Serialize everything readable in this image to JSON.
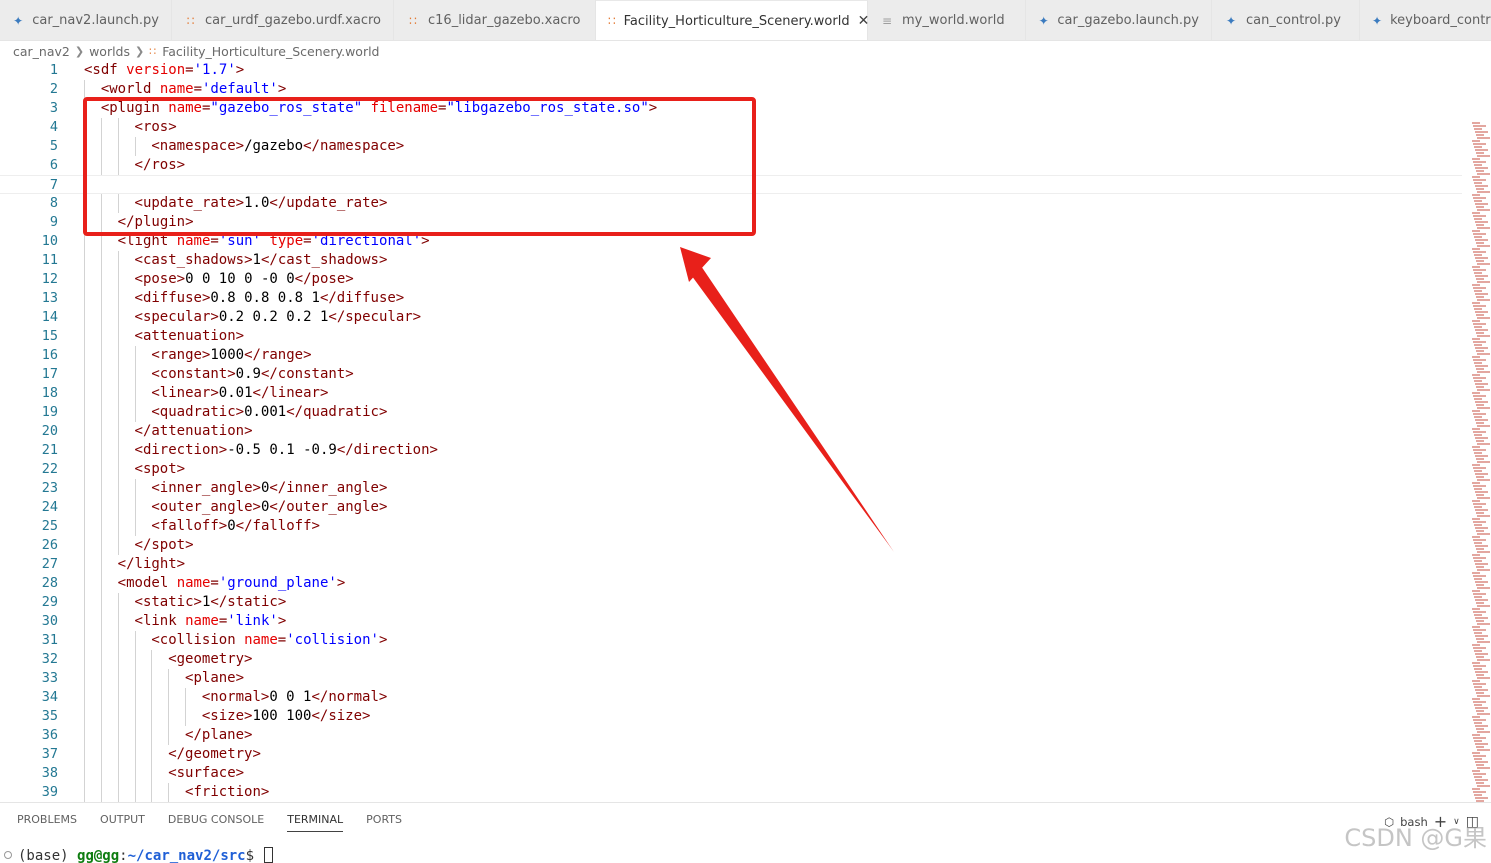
{
  "tabs": [
    {
      "label": "car_nav2.launch.py",
      "icon": "python-icon",
      "active": false
    },
    {
      "label": "car_urdf_gazebo.urdf.xacro",
      "icon": "rss-icon",
      "active": false
    },
    {
      "label": "c16_lidar_gazebo.xacro",
      "icon": "rss-icon",
      "active": false
    },
    {
      "label": "Facility_Horticulture_Scenery.world",
      "icon": "rss-icon",
      "active": true
    },
    {
      "label": "my_world.world",
      "icon": "lines-icon",
      "active": false
    },
    {
      "label": "car_gazebo.launch.py",
      "icon": "python-icon",
      "active": false
    },
    {
      "label": "can_control.py",
      "icon": "python-icon",
      "active": false
    },
    {
      "label": "keyboard_control.",
      "icon": "python-icon",
      "active": false
    }
  ],
  "breadcrumb": [
    "car_nav2",
    "worlds",
    "Facility_Horticulture_Scenery.world"
  ],
  "editor": {
    "current_line": 7,
    "lines": [
      {
        "n": "1",
        "indent": 0,
        "tokens": [
          [
            "tag",
            "<sdf "
          ],
          [
            "attr",
            "version"
          ],
          [
            "tag",
            "="
          ],
          [
            "str",
            "'1.7'"
          ],
          [
            "tag",
            ">"
          ]
        ]
      },
      {
        "n": "2",
        "indent": 1,
        "tokens": [
          [
            "tag",
            "<world "
          ],
          [
            "attr",
            "name"
          ],
          [
            "tag",
            "="
          ],
          [
            "str",
            "'default'"
          ],
          [
            "tag",
            ">"
          ]
        ]
      },
      {
        "n": "3",
        "indent": 1,
        "tokens": [
          [
            "tag",
            "<plugin "
          ],
          [
            "attr",
            "name"
          ],
          [
            "tag",
            "="
          ],
          [
            "str",
            "\"gazebo_ros_state\""
          ],
          [
            "tag",
            " "
          ],
          [
            "attr",
            "filename"
          ],
          [
            "tag",
            "="
          ],
          [
            "str",
            "\"libgazebo_ros_state.so\""
          ],
          [
            "tag",
            ">"
          ]
        ]
      },
      {
        "n": "4",
        "indent": 3,
        "tokens": [
          [
            "tag",
            "<ros>"
          ]
        ]
      },
      {
        "n": "5",
        "indent": 4,
        "tokens": [
          [
            "tag",
            "<namespace>"
          ],
          [
            "text",
            "/gazebo"
          ],
          [
            "tag",
            "</namespace>"
          ]
        ]
      },
      {
        "n": "6",
        "indent": 3,
        "tokens": [
          [
            "tag",
            "</ros>"
          ]
        ]
      },
      {
        "n": "7",
        "indent": 0,
        "tokens": []
      },
      {
        "n": "8",
        "indent": 3,
        "tokens": [
          [
            "tag",
            "<update_rate>"
          ],
          [
            "text",
            "1.0"
          ],
          [
            "tag",
            "</update_rate>"
          ]
        ]
      },
      {
        "n": "9",
        "indent": 2,
        "tokens": [
          [
            "tag",
            "</plugin>"
          ]
        ]
      },
      {
        "n": "10",
        "indent": 2,
        "tokens": [
          [
            "tag",
            "<light "
          ],
          [
            "attr",
            "name"
          ],
          [
            "tag",
            "="
          ],
          [
            "str",
            "'sun'"
          ],
          [
            "tag",
            " "
          ],
          [
            "attr",
            "type"
          ],
          [
            "tag",
            "="
          ],
          [
            "str",
            "'directional'"
          ],
          [
            "tag",
            ">"
          ]
        ]
      },
      {
        "n": "11",
        "indent": 3,
        "tokens": [
          [
            "tag",
            "<cast_shadows>"
          ],
          [
            "text",
            "1"
          ],
          [
            "tag",
            "</cast_shadows>"
          ]
        ]
      },
      {
        "n": "12",
        "indent": 3,
        "tokens": [
          [
            "tag",
            "<pose>"
          ],
          [
            "text",
            "0 0 10 0 -0 0"
          ],
          [
            "tag",
            "</pose>"
          ]
        ]
      },
      {
        "n": "13",
        "indent": 3,
        "tokens": [
          [
            "tag",
            "<diffuse>"
          ],
          [
            "text",
            "0.8 0.8 0.8 1"
          ],
          [
            "tag",
            "</diffuse>"
          ]
        ]
      },
      {
        "n": "14",
        "indent": 3,
        "tokens": [
          [
            "tag",
            "<specular>"
          ],
          [
            "text",
            "0.2 0.2 0.2 1"
          ],
          [
            "tag",
            "</specular>"
          ]
        ]
      },
      {
        "n": "15",
        "indent": 3,
        "tokens": [
          [
            "tag",
            "<attenuation>"
          ]
        ]
      },
      {
        "n": "16",
        "indent": 4,
        "tokens": [
          [
            "tag",
            "<range>"
          ],
          [
            "text",
            "1000"
          ],
          [
            "tag",
            "</range>"
          ]
        ]
      },
      {
        "n": "17",
        "indent": 4,
        "tokens": [
          [
            "tag",
            "<constant>"
          ],
          [
            "text",
            "0.9"
          ],
          [
            "tag",
            "</constant>"
          ]
        ]
      },
      {
        "n": "18",
        "indent": 4,
        "tokens": [
          [
            "tag",
            "<linear>"
          ],
          [
            "text",
            "0.01"
          ],
          [
            "tag",
            "</linear>"
          ]
        ]
      },
      {
        "n": "19",
        "indent": 4,
        "tokens": [
          [
            "tag",
            "<quadratic>"
          ],
          [
            "text",
            "0.001"
          ],
          [
            "tag",
            "</quadratic>"
          ]
        ]
      },
      {
        "n": "20",
        "indent": 3,
        "tokens": [
          [
            "tag",
            "</attenuation>"
          ]
        ]
      },
      {
        "n": "21",
        "indent": 3,
        "tokens": [
          [
            "tag",
            "<direction>"
          ],
          [
            "text",
            "-0.5 0.1 -0.9"
          ],
          [
            "tag",
            "</direction>"
          ]
        ]
      },
      {
        "n": "22",
        "indent": 3,
        "tokens": [
          [
            "tag",
            "<spot>"
          ]
        ]
      },
      {
        "n": "23",
        "indent": 4,
        "tokens": [
          [
            "tag",
            "<inner_angle>"
          ],
          [
            "text",
            "0"
          ],
          [
            "tag",
            "</inner_angle>"
          ]
        ]
      },
      {
        "n": "24",
        "indent": 4,
        "tokens": [
          [
            "tag",
            "<outer_angle>"
          ],
          [
            "text",
            "0"
          ],
          [
            "tag",
            "</outer_angle>"
          ]
        ]
      },
      {
        "n": "25",
        "indent": 4,
        "tokens": [
          [
            "tag",
            "<falloff>"
          ],
          [
            "text",
            "0"
          ],
          [
            "tag",
            "</falloff>"
          ]
        ]
      },
      {
        "n": "26",
        "indent": 3,
        "tokens": [
          [
            "tag",
            "</spot>"
          ]
        ]
      },
      {
        "n": "27",
        "indent": 2,
        "tokens": [
          [
            "tag",
            "</light>"
          ]
        ]
      },
      {
        "n": "28",
        "indent": 2,
        "tokens": [
          [
            "tag",
            "<model "
          ],
          [
            "attr",
            "name"
          ],
          [
            "tag",
            "="
          ],
          [
            "str",
            "'ground_plane'"
          ],
          [
            "tag",
            ">"
          ]
        ]
      },
      {
        "n": "29",
        "indent": 3,
        "tokens": [
          [
            "tag",
            "<static>"
          ],
          [
            "text",
            "1"
          ],
          [
            "tag",
            "</static>"
          ]
        ]
      },
      {
        "n": "30",
        "indent": 3,
        "tokens": [
          [
            "tag",
            "<link "
          ],
          [
            "attr",
            "name"
          ],
          [
            "tag",
            "="
          ],
          [
            "str",
            "'link'"
          ],
          [
            "tag",
            ">"
          ]
        ]
      },
      {
        "n": "31",
        "indent": 4,
        "tokens": [
          [
            "tag",
            "<collision "
          ],
          [
            "attr",
            "name"
          ],
          [
            "tag",
            "="
          ],
          [
            "str",
            "'collision'"
          ],
          [
            "tag",
            ">"
          ]
        ]
      },
      {
        "n": "32",
        "indent": 5,
        "tokens": [
          [
            "tag",
            "<geometry>"
          ]
        ]
      },
      {
        "n": "33",
        "indent": 6,
        "tokens": [
          [
            "tag",
            "<plane>"
          ]
        ]
      },
      {
        "n": "34",
        "indent": 7,
        "tokens": [
          [
            "tag",
            "<normal>"
          ],
          [
            "text",
            "0 0 1"
          ],
          [
            "tag",
            "</normal>"
          ]
        ]
      },
      {
        "n": "35",
        "indent": 7,
        "tokens": [
          [
            "tag",
            "<size>"
          ],
          [
            "text",
            "100 100"
          ],
          [
            "tag",
            "</size>"
          ]
        ]
      },
      {
        "n": "36",
        "indent": 6,
        "tokens": [
          [
            "tag",
            "</plane>"
          ]
        ]
      },
      {
        "n": "37",
        "indent": 5,
        "tokens": [
          [
            "tag",
            "</geometry>"
          ]
        ]
      },
      {
        "n": "38",
        "indent": 5,
        "tokens": [
          [
            "tag",
            "<surface>"
          ]
        ]
      },
      {
        "n": "39",
        "indent": 6,
        "tokens": [
          [
            "tag",
            "<friction>"
          ]
        ]
      }
    ]
  },
  "panel": {
    "tabs": [
      "PROBLEMS",
      "OUTPUT",
      "DEBUG CONSOLE",
      "TERMINAL",
      "PORTS"
    ],
    "active_tab": "TERMINAL",
    "shell_label": "bash",
    "terminal": {
      "prefix": "(base) ",
      "user": "gg@gg",
      "sep": ":",
      "path": "~/car_nav2/src",
      "prompt": "$ "
    }
  },
  "watermark": "CSDN @G果",
  "colors": {
    "highlight": "#e8201a",
    "tag": "#800000",
    "attr": "#e50000",
    "string": "#0000ff",
    "line_number": "#237893"
  }
}
